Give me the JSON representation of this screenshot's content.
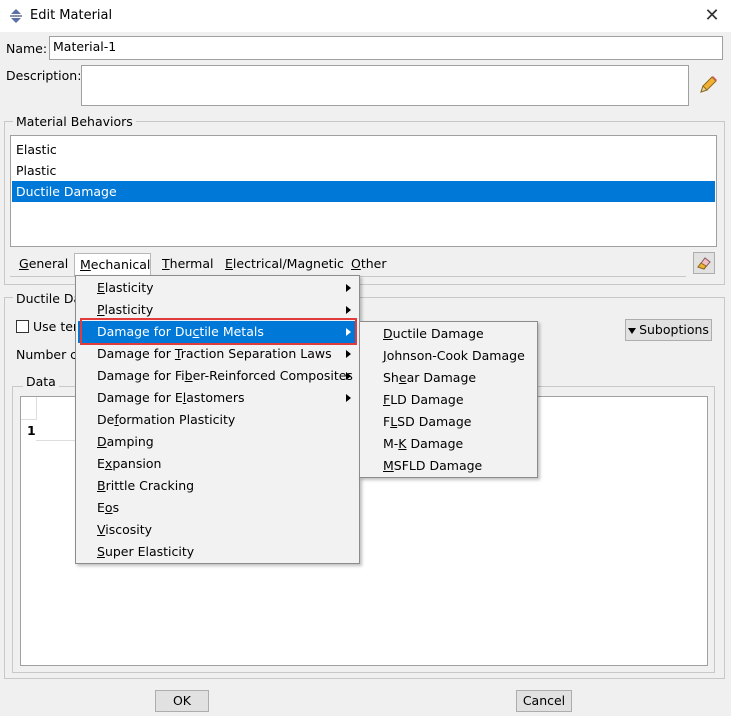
{
  "window": {
    "title": "Edit Material"
  },
  "name": {
    "label": "Name:",
    "value": "Material-1"
  },
  "description": {
    "label": "Description:",
    "value": ""
  },
  "behaviors": {
    "group_title": "Material Behaviors",
    "items": [
      {
        "label": "Elastic"
      },
      {
        "label": "Plastic"
      },
      {
        "label": "Ductile Damage"
      }
    ],
    "selected": "Ductile Damage"
  },
  "tabs": [
    {
      "pre": "",
      "u": "G",
      "post": "eneral"
    },
    {
      "pre": "",
      "u": "M",
      "post": "echanical"
    },
    {
      "pre": "",
      "u": "T",
      "post": "hermal"
    },
    {
      "pre": "",
      "u": "E",
      "post": "lectrical/Magnetic"
    },
    {
      "pre": "",
      "u": "O",
      "post": "ther"
    }
  ],
  "editor": {
    "group_title": "Ductile Da",
    "use_temp_label": "Use ter",
    "number_label": "Number c",
    "suboptions_label": "Suboptions",
    "data_title": "Data",
    "row_number": "1"
  },
  "mechanical_menu": [
    {
      "pre": "",
      "u": "E",
      "post": "lasticity",
      "submenu": true
    },
    {
      "pre": "",
      "u": "P",
      "post": "lasticity",
      "submenu": true
    },
    {
      "pre": "Damage for Du",
      "u": "c",
      "post": "tile Metals",
      "submenu": true,
      "highlighted": true
    },
    {
      "pre": "Damage for ",
      "u": "T",
      "post": "raction Separation Laws",
      "submenu": true
    },
    {
      "pre": "Damage for Fi",
      "u": "b",
      "post": "er-Reinforced Composites",
      "submenu": true
    },
    {
      "pre": "Damage for E",
      "u": "l",
      "post": "astomers",
      "submenu": true
    },
    {
      "pre": "De",
      "u": "f",
      "post": "ormation Plasticity",
      "submenu": false
    },
    {
      "pre": "",
      "u": "D",
      "post": "amping",
      "submenu": false
    },
    {
      "pre": "E",
      "u": "x",
      "post": "pansion",
      "submenu": false
    },
    {
      "pre": "",
      "u": "B",
      "post": "rittle Cracking",
      "submenu": false
    },
    {
      "pre": "E",
      "u": "o",
      "post": "s",
      "submenu": false
    },
    {
      "pre": "",
      "u": "V",
      "post": "iscosity",
      "submenu": false
    },
    {
      "pre": "",
      "u": "S",
      "post": "uper Elasticity",
      "submenu": false
    }
  ],
  "ductile_submenu": [
    {
      "pre": "",
      "u": "D",
      "post": "uctile Damage"
    },
    {
      "pre": "",
      "u": "J",
      "post": "ohnson-Cook Damage"
    },
    {
      "pre": "Sh",
      "u": "e",
      "post": "ar Damage"
    },
    {
      "pre": "",
      "u": "F",
      "post": "LD Damage"
    },
    {
      "pre": "F",
      "u": "L",
      "post": "SD Damage"
    },
    {
      "pre": "M-",
      "u": "K",
      "post": " Damage"
    },
    {
      "pre": "",
      "u": "M",
      "post": "SFLD Damage"
    }
  ],
  "buttons": {
    "ok": "OK",
    "cancel": "Cancel"
  },
  "colors": {
    "selection": "#0078d7",
    "callout": "#e03c3c"
  },
  "icons": {
    "title": "app-icon",
    "close": "close-icon",
    "edit": "pencil-icon",
    "tab_edit": "eraser-icon",
    "suboptions": "triangle-down-icon"
  }
}
